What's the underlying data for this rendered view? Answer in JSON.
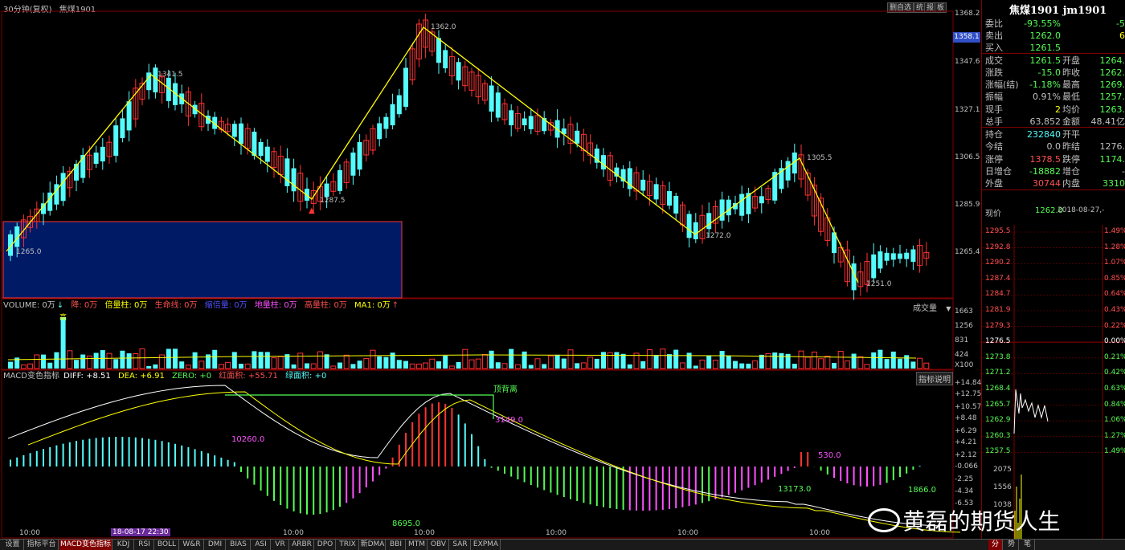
{
  "header": {
    "period": "30分钟(复权)",
    "symbol_short": "焦煤1901",
    "tools": [
      "删自选",
      "统",
      "报",
      "板"
    ]
  },
  "colors": {
    "up": "#ff3232",
    "down": "#54fcfc",
    "wave": "#ffff00",
    "grid": "#800000",
    "highlight_box": "#001a66"
  },
  "price_axis": [
    "1368.2",
    "1347.6",
    "1327.1",
    "1306.5",
    "1285.9",
    "1265.4"
  ],
  "current_price_tag": "1358.1",
  "wave_labels": [
    {
      "text": "1341.5"
    },
    {
      "text": "1265.0"
    },
    {
      "text": "1362.0"
    },
    {
      "text": "1287.5"
    },
    {
      "text": "1272.0"
    },
    {
      "text": "1305.5"
    },
    {
      "text": "1251.0"
    }
  ],
  "volume": {
    "title": "VOLUME: 0万",
    "items": [
      {
        "label": "降: 0万",
        "color": "#ff5050"
      },
      {
        "label": "倍量柱: 0万",
        "color": "#ffff00"
      },
      {
        "label": "生命线: 0万",
        "color": "#ff5050"
      },
      {
        "label": "缩倍量: 0万",
        "color": "#5050ff"
      },
      {
        "label": "地量柱: 0万",
        "color": "#ff50ff"
      },
      {
        "label": "高量柱: 0万",
        "color": "#ff5050"
      },
      {
        "label": "MA1: 0万",
        "color": "#ffff00"
      }
    ],
    "right_label": "成交量",
    "axis": [
      "1663",
      "1256",
      "831",
      "424",
      "X100"
    ],
    "high_mark": "高"
  },
  "macd": {
    "title": "MACD变色指标",
    "diff": "DIFF: +8.51",
    "dea": "DEA: +6.91",
    "zero": "ZERO: +0",
    "red_area": "红面积: +55.71",
    "green_area": "绿面积: +0",
    "right_label": "指标说明",
    "axis": [
      "+14.84",
      "+12.75",
      "+10.57",
      "+8.48",
      "+6.29",
      "+4.21",
      "+2.12",
      "-0.066",
      "-2.25",
      "-4.34",
      "-6.53"
    ],
    "annotations": [
      "顶背离",
      "10260.0",
      "3149.0",
      "530.0",
      "13173.0",
      "1866.0",
      "8695.0"
    ]
  },
  "time_axis": [
    "10:00",
    "10:00",
    "10:00",
    "10:00",
    "10:00",
    "10:00",
    "10:00"
  ],
  "date_marker": "18-08-17 22:30",
  "quote": {
    "title": "焦煤1901 jm1901",
    "rows": [
      {
        "l": "委比",
        "v": "-93.55%",
        "vc": "#54fc54",
        "l2": "",
        "v2": "-5",
        "v2c": "#54fc54"
      },
      {
        "l": "卖出",
        "v": "1262.0",
        "vc": "#54fc54",
        "l2": "",
        "v2": "6",
        "v2c": "#ffff00"
      },
      {
        "l": "买入",
        "v": "1261.5",
        "vc": "#54fc54",
        "l2": "",
        "v2": "",
        "v2c": "#c0c0c0"
      },
      {
        "l": "成交",
        "v": "1261.5",
        "vc": "#54fc54",
        "l2": "开盘",
        "v2": "1264.",
        "v2c": "#54fc54"
      },
      {
        "l": "涨跌",
        "v": "-15.0",
        "vc": "#54fc54",
        "l2": "昨收",
        "v2": "1262.",
        "v2c": "#54fc54"
      },
      {
        "l": "涨幅(结)",
        "v": "-1.18%",
        "vc": "#54fc54",
        "l2": "最高",
        "v2": "1269.",
        "v2c": "#54fc54"
      },
      {
        "l": "振幅",
        "v": "0.91%",
        "vc": "#c0c0c0",
        "l2": "最低",
        "v2": "1257.",
        "v2c": "#54fc54"
      },
      {
        "l": "现手",
        "v": "2",
        "vc": "#ffff00",
        "l2": "均价",
        "v2": "1263.",
        "v2c": "#54fc54"
      },
      {
        "l": "总手",
        "v": "63,852",
        "vc": "#c0c0c0",
        "l2": "金额",
        "v2": "48.41亿",
        "v2c": "#c0c0c0"
      },
      {
        "l": "持仓",
        "v": "232840",
        "vc": "#54fcfc",
        "l2": "开平",
        "v2": "",
        "v2c": "#c0c0c0"
      },
      {
        "l": "今结",
        "v": "0.0",
        "vc": "#c0c0c0",
        "l2": "昨结",
        "v2": "1276.",
        "v2c": "#c0c0c0"
      },
      {
        "l": "涨停",
        "v": "1378.5",
        "vc": "#ff5050",
        "l2": "跌停",
        "v2": "1174.",
        "v2c": "#54fc54"
      },
      {
        "l": "日增仓",
        "v": "-18882",
        "vc": "#54fc54",
        "l2": "增仓",
        "v2": "-",
        "v2c": "#c0c0c0"
      },
      {
        "l": "外盘",
        "v": "30744",
        "vc": "#ff5050",
        "l2": "内盘",
        "v2": "3310",
        "v2c": "#54fc54"
      }
    ],
    "spot_label": "现价",
    "spot_value": "1262.0",
    "spot_date": "2018-08-27,-"
  },
  "mini_chart": {
    "left_axis": [
      "1295.5",
      "1292.8",
      "1290.2",
      "1287.4",
      "1284.7",
      "1281.9",
      "1279.3",
      "1276.5",
      "1273.8",
      "1271.2",
      "1268.4",
      "1265.7",
      "1262.9",
      "1260.3",
      "1257.5"
    ],
    "right_axis": [
      "1.49%",
      "1.28%",
      "1.07%",
      "0.85%",
      "0.64%",
      "0.43%",
      "0.22%",
      "0.00%",
      "0.21%",
      "0.42%",
      "0.63%",
      "0.84%",
      "1.06%",
      "1.27%",
      "1.49%"
    ],
    "vol_axis": [
      "2075",
      "1556",
      "1038"
    ]
  },
  "tabs": [
    "设置",
    "指标平台",
    "MACD变色指标",
    "KDJ",
    "RSI",
    "BOLL",
    "W&R",
    "DMI",
    "BIAS",
    "ASI",
    "VR",
    "ARBR",
    "DPO",
    "TRIX",
    "新DMA",
    "BBI",
    "MTM",
    "OBV",
    "SAR",
    "EXPMA"
  ],
  "bottom_right": [
    "分",
    "势",
    "笔"
  ],
  "watermark": "黄磊的期货人生"
}
